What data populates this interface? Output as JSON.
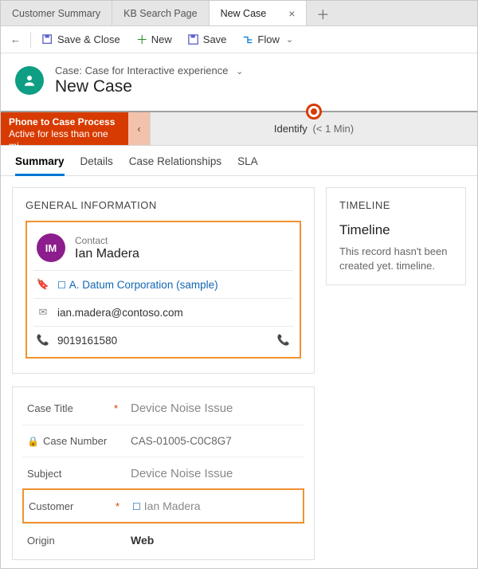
{
  "tabs": {
    "items": [
      {
        "label": "Customer Summary"
      },
      {
        "label": "KB Search Page"
      },
      {
        "label": "New Case"
      }
    ]
  },
  "commands": {
    "save_close": "Save & Close",
    "new": "New",
    "save": "Save",
    "flow": "Flow"
  },
  "header": {
    "breadcrumb": "Case: Case for Interactive experience",
    "title": "New Case"
  },
  "process": {
    "name": "Phone to Case Process",
    "status": "Active for less than one mi…",
    "stage_label": "Identify",
    "stage_time": "(< 1 Min)"
  },
  "form_tabs": {
    "items": [
      {
        "label": "Summary"
      },
      {
        "label": "Details"
      },
      {
        "label": "Case Relationships"
      },
      {
        "label": "SLA"
      }
    ]
  },
  "general_info": {
    "section_title": "GENERAL INFORMATION",
    "contact_label": "Contact",
    "contact_name": "Ian Madera",
    "contact_initials": "IM",
    "account": "A. Datum Corporation (sample)",
    "email": "ian.madera@contoso.com",
    "phone": "9019161580"
  },
  "case_fields": {
    "case_title_label": "Case Title",
    "case_title_value": "Device Noise Issue",
    "case_number_label": "Case Number",
    "case_number_value": "CAS-01005-C0C8G7",
    "subject_label": "Subject",
    "subject_value": "Device Noise Issue",
    "customer_label": "Customer",
    "customer_value": "Ian Madera",
    "origin_label": "Origin",
    "origin_value": "Web"
  },
  "timeline": {
    "section_title": "TIMELINE",
    "heading": "Timeline",
    "message": "This record hasn't been created yet. timeline."
  }
}
